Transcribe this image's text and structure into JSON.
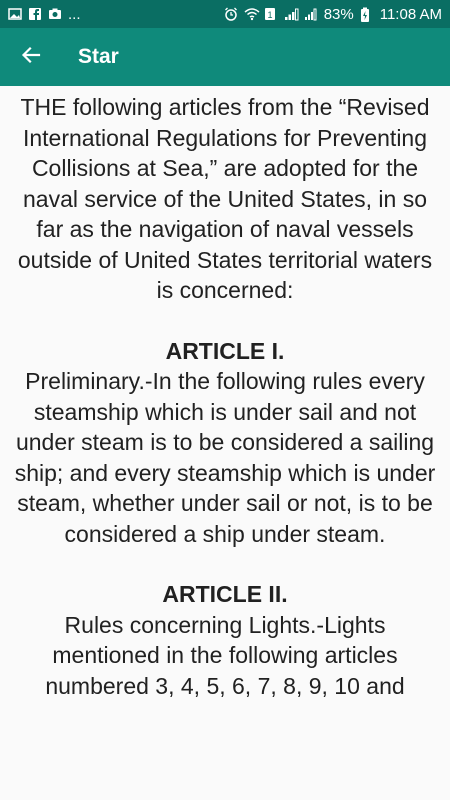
{
  "status_bar": {
    "left_icons": [
      "image-icon",
      "facebook-icon",
      "camera-icon"
    ],
    "more": "...",
    "battery": "83%",
    "time": "11:08 AM"
  },
  "app_bar": {
    "title": "Star"
  },
  "article": {
    "intro": "THE following articles from the “Revised International Regulations for Preventing Collisions at Sea,” are adopted for the naval service of the United States, in so far as the navigation of naval vessels outside of United States territorial waters is concerned:",
    "sections": [
      {
        "heading": "ARTICLE I.",
        "body": "Preliminary.-In the following rules every steamship which is under sail and not under steam is to be considered a sailing ship; and every steamship which is under steam, whether under sail or not, is to be considered a ship under steam."
      },
      {
        "heading": "ARTICLE II.",
        "body": "Rules concerning Lights.-Lights mentioned in the following articles numbered 3, 4, 5, 6, 7, 8, 9, 10 and"
      }
    ]
  }
}
